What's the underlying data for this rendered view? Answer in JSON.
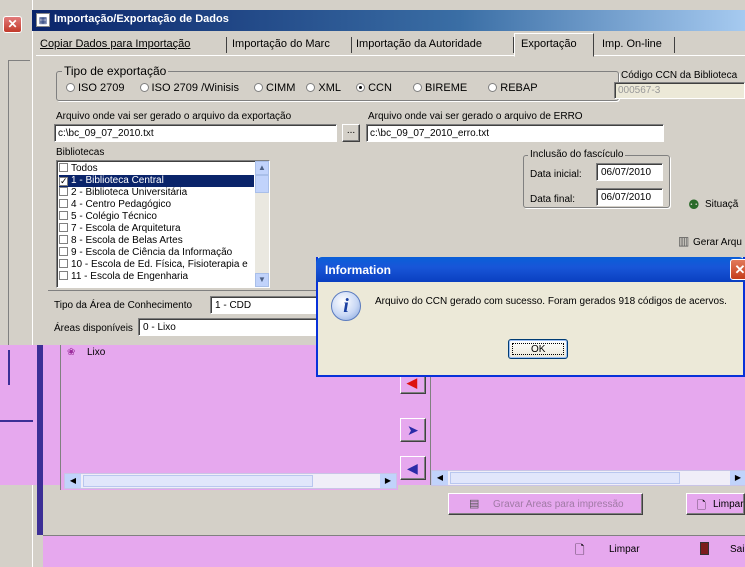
{
  "window": {
    "title": "Importação/Exportação de Dados"
  },
  "tabs": [
    {
      "label": "Copiar Dados para Importação"
    },
    {
      "label": "Importação do Marc"
    },
    {
      "label": "Importação da Autoridade"
    },
    {
      "label": "Exportação"
    },
    {
      "label": "Imp. On-line"
    }
  ],
  "export_type": {
    "legend": "Tipo de exportação",
    "options": [
      "ISO 2709",
      "ISO 2709 /Winisis",
      "CIMM",
      "XML",
      "CCN",
      "BIREME",
      "REBAP"
    ],
    "selected": "CCN"
  },
  "ccn_code": {
    "label": "Código CCN da Biblioteca",
    "value": "000567-3"
  },
  "export_file": {
    "label": "Arquivo onde vai ser gerado o arquivo da exportação",
    "value": "c:\\bc_09_07_2010.txt",
    "browse": "..."
  },
  "error_file": {
    "label": "Arquivo onde vai ser gerado o arquivo de ERRO",
    "value": "c:\\bc_09_07_2010_erro.txt"
  },
  "libraries": {
    "label": "Bibliotecas",
    "items": [
      {
        "text": "Todos",
        "checked": false
      },
      {
        "text": "1 - Biblioteca Central",
        "checked": true
      },
      {
        "text": "2 - Biblioteca Universitária",
        "checked": false
      },
      {
        "text": "4 - Centro Pedagógico",
        "checked": false
      },
      {
        "text": "5 - Colégio Técnico",
        "checked": false
      },
      {
        "text": "7 - Escola de Arquitetura",
        "checked": false
      },
      {
        "text": "8 - Escola de Belas Artes",
        "checked": false
      },
      {
        "text": "9 - Escola de Ciência da Informação",
        "checked": false
      },
      {
        "text": "10 - Escola de Ed. Física, Fisioterapia e",
        "checked": false
      },
      {
        "text": "11 - Escola de Engenharia",
        "checked": false
      }
    ]
  },
  "fasciculo": {
    "legend": "Inclusão do fascículo",
    "start_label": "Data inicial:",
    "start_value": "06/07/2010",
    "end_label": "Data final:",
    "end_value": "06/07/2010"
  },
  "side_buttons": {
    "situacao": "Situaçã",
    "gerar": "Gerar Arqu"
  },
  "knowledge": {
    "type_label": "Tipo da Área de Conhecimento",
    "type_value": "1 - CDD",
    "available_label": "Áreas disponíveis",
    "available_value": "0 - Lixo",
    "list_item": "Lixo"
  },
  "bottom": {
    "save_areas": "Gravar Areas para impressão",
    "limpar_inner": "Limpar",
    "limpar": "Limpar",
    "sair": "Sai"
  },
  "dialog": {
    "title": "Information",
    "message": "Arquivo do CCN gerado com sucesso. Foram gerados 918 códigos de acervos.",
    "ok": "OK"
  },
  "colors": {
    "titlebar": "#0a246a",
    "xp_blue": "#1856d8",
    "overlay": "#e6a8ee",
    "overlay_border": "#3c2f96",
    "selection": "#0a246a"
  }
}
